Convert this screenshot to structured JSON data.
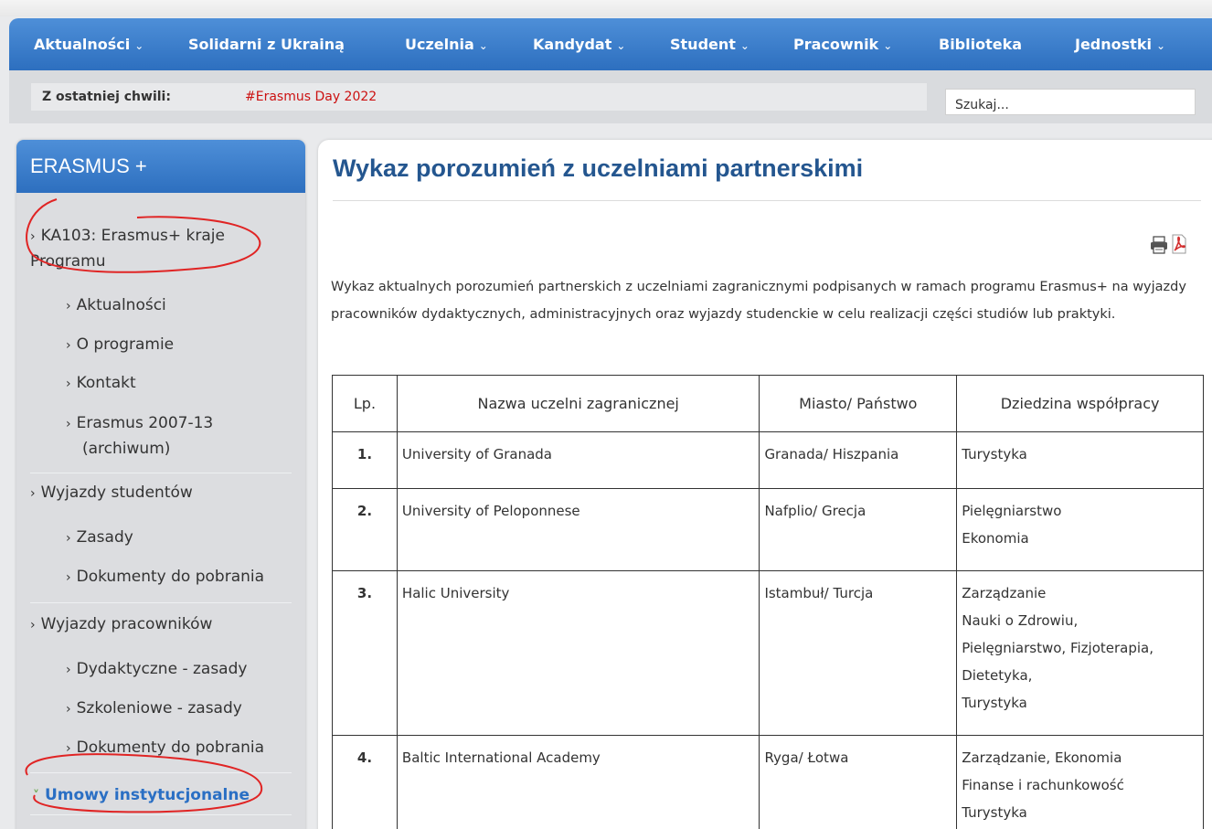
{
  "nav": {
    "items": [
      {
        "label": "Aktualności",
        "has_dropdown": true
      },
      {
        "label": "Solidarni z Ukrainą",
        "has_dropdown": false
      },
      {
        "label": "Uczelnia",
        "has_dropdown": true
      },
      {
        "label": "Kandydat",
        "has_dropdown": true
      },
      {
        "label": "Student",
        "has_dropdown": true
      },
      {
        "label": "Pracownik",
        "has_dropdown": true
      },
      {
        "label": "Biblioteka",
        "has_dropdown": false
      },
      {
        "label": "Jednostki",
        "has_dropdown": true
      }
    ],
    "chevron": "⌄"
  },
  "news": {
    "label": "Z ostatniej chwili:",
    "link": "#Erasmus Day 2022",
    "link_color": "#cc1111"
  },
  "search": {
    "placeholder": "Szukaj..."
  },
  "sidebar": {
    "title": "ERASMUS +",
    "arrow": "›",
    "items": [
      {
        "label": "KA103: Erasmus+ kraje Programu"
      },
      {
        "label": "Aktualności"
      },
      {
        "label": "O programie"
      },
      {
        "label": "Kontakt"
      },
      {
        "label": "Erasmus 2007-13 (archiwum)"
      },
      {
        "label": "Wyjazdy studentów"
      },
      {
        "label": "Zasady"
      },
      {
        "label": "Dokumenty do pobrania"
      },
      {
        "label": "Wyjazdy pracowników"
      },
      {
        "label": "Dydaktyczne - zasady"
      },
      {
        "label": "Szkoleniowe - zasady"
      },
      {
        "label": "Dokumenty do pobrania"
      },
      {
        "label": "Umowy instytucjonalne",
        "active": true
      }
    ]
  },
  "content": {
    "title": "Wykaz porozumień z uczelniami partnerskimi",
    "intro": "Wykaz aktualnych porozumień partnerskich z uczelniami zagranicznymi  podpisanych w ramach programu Erasmus+ na wyjazdy pracowników dydaktycznych, administracyjnych oraz wyjazdy studenckie w celu realizacji części studiów lub praktyki.",
    "table": {
      "headers": [
        "Lp.",
        "Nazwa uczelni zagranicznej",
        "Miasto/ Państwo",
        "Dziedzina współpracy"
      ],
      "rows": [
        {
          "lp": "1.",
          "name": "University of Granada",
          "city": "Granada/ Hiszpania",
          "fields": [
            "Turystyka"
          ]
        },
        {
          "lp": "2.",
          "name": "University of Peloponnese",
          "city": "Nafplio/ Grecja",
          "fields": [
            "Pielęgniarstwo",
            "Ekonomia"
          ]
        },
        {
          "lp": "3.",
          "name": "Halic University",
          "city": "Istambuł/ Turcja",
          "fields": [
            "Zarządzanie",
            "Nauki o Zdrowiu,",
            "Pielęgniarstwo, Fizjoterapia,",
            "Dietetyka,",
            "Turystyka"
          ]
        },
        {
          "lp": "4.",
          "name": "Baltic International Academy",
          "city": "Ryga/  Łotwa",
          "fields": [
            "Zarządzanie, Ekonomia",
            "Finanse i rachunkowość",
            "Turystyka"
          ]
        }
      ]
    }
  },
  "colors": {
    "nav_blue": "#2d6fbf",
    "title_blue": "#24568f",
    "annotation_red": "#e02424",
    "active_link": "#2a6fc4"
  }
}
